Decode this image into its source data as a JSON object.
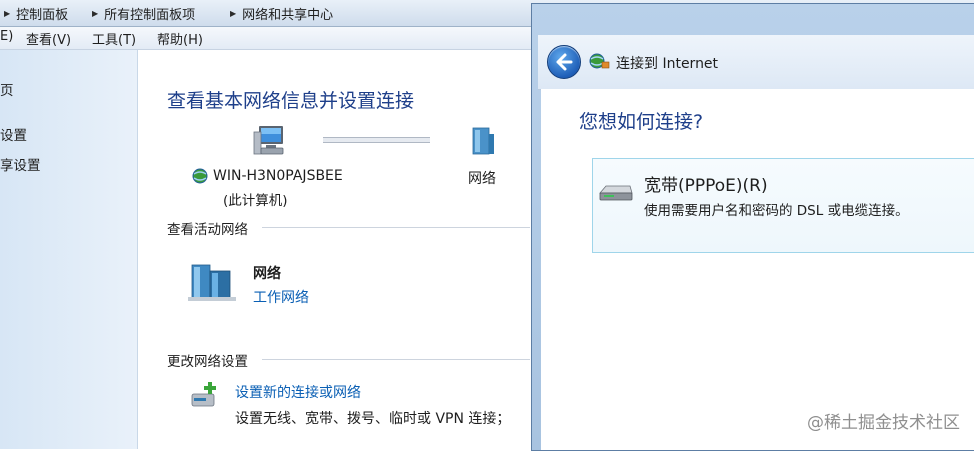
{
  "control_panel": {
    "breadcrumb": [
      "控制面板",
      "所有控制面板项",
      "网络和共享中心"
    ],
    "menu": [
      "E)",
      "查看(V)",
      "工具(T)",
      "帮助(H)"
    ],
    "sidebar": [
      "页",
      "设置",
      "享设置"
    ],
    "page_title": "查看基本网络信息并设置连接",
    "computer_name": "WIN-H3N0PAJSBEE",
    "computer_sub": "(此计算机)",
    "network_label": "网络",
    "active_heading": "查看活动网络",
    "active_network": {
      "name": "网络",
      "type": "工作网络"
    },
    "change_heading": "更改网络设置",
    "setup_link": "设置新的连接或网络",
    "setup_desc": "设置无线、宽带、拨号、临时或 VPN 连接；"
  },
  "dialog": {
    "title": "连接到 Internet",
    "question": "您想如何连接?",
    "option": {
      "title": "宽带(PPPoE)(R)",
      "description": "使用需要用户名和密码的 DSL 或电缆连接。"
    }
  },
  "watermark": "@稀土掘金技术社区"
}
